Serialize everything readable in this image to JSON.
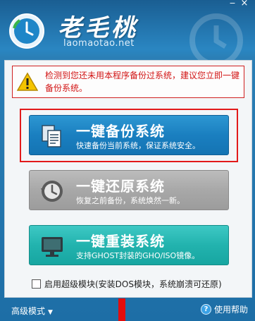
{
  "app": {
    "brand_name": "老毛桃",
    "brand_url": "laomaotao.net"
  },
  "window_controls": {
    "minimize_icon": "minimize-icon",
    "close_icon": "close-icon",
    "minimize_glyph": "−",
    "close_glyph": "×"
  },
  "warning": {
    "icon": "warning-triangle-icon",
    "text": "检测到您还未用本程序备份过系统，建议您立即一键备份系统。"
  },
  "actions": [
    {
      "title": "一键备份系统",
      "subtitle": "快速备份当前系统，保证系统安全。",
      "icon": "documents-icon",
      "color": "#1a7fc0"
    },
    {
      "title": "一键还原系统",
      "subtitle": "恢复之前备份，系统焕然一新。",
      "icon": "restore-clock-icon",
      "color": "#a8a8a8"
    },
    {
      "title": "一键重装系统",
      "subtitle": "支持GHOST封装的GHO/ISO镜像。",
      "icon": "monitor-icon",
      "color": "#22b3ae"
    }
  ],
  "option": {
    "checked": false,
    "label": "启用超级模块(安装DOS模块，系统崩溃可还原)"
  },
  "footer": {
    "advanced_label": "高级模式",
    "advanced_caret": "▼",
    "help_label": "使用帮助",
    "help_glyph": "?"
  }
}
